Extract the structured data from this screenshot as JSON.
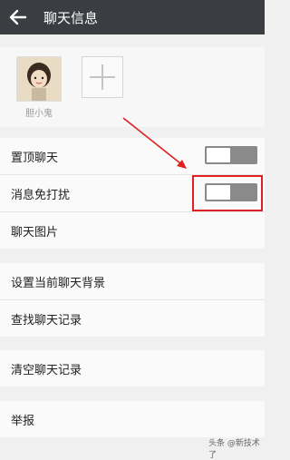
{
  "header": {
    "title": "聊天信息"
  },
  "members": {
    "items": [
      {
        "name": "胆小鬼"
      }
    ]
  },
  "settings": {
    "group1": [
      {
        "label": "置顶聊天",
        "toggle": "off"
      },
      {
        "label": "消息免打扰",
        "toggle": "off"
      },
      {
        "label": "聊天图片"
      }
    ],
    "group2": [
      {
        "label": "设置当前聊天背景"
      },
      {
        "label": "查找聊天记录"
      }
    ],
    "group3": [
      {
        "label": "清空聊天记录"
      }
    ],
    "group4": [
      {
        "label": "举报"
      }
    ]
  },
  "watermark": "头条 @新技术了",
  "colors": {
    "titlebar": "#3a3e42",
    "highlight": "#e02020",
    "toggle_off": "#8a8a8a"
  }
}
